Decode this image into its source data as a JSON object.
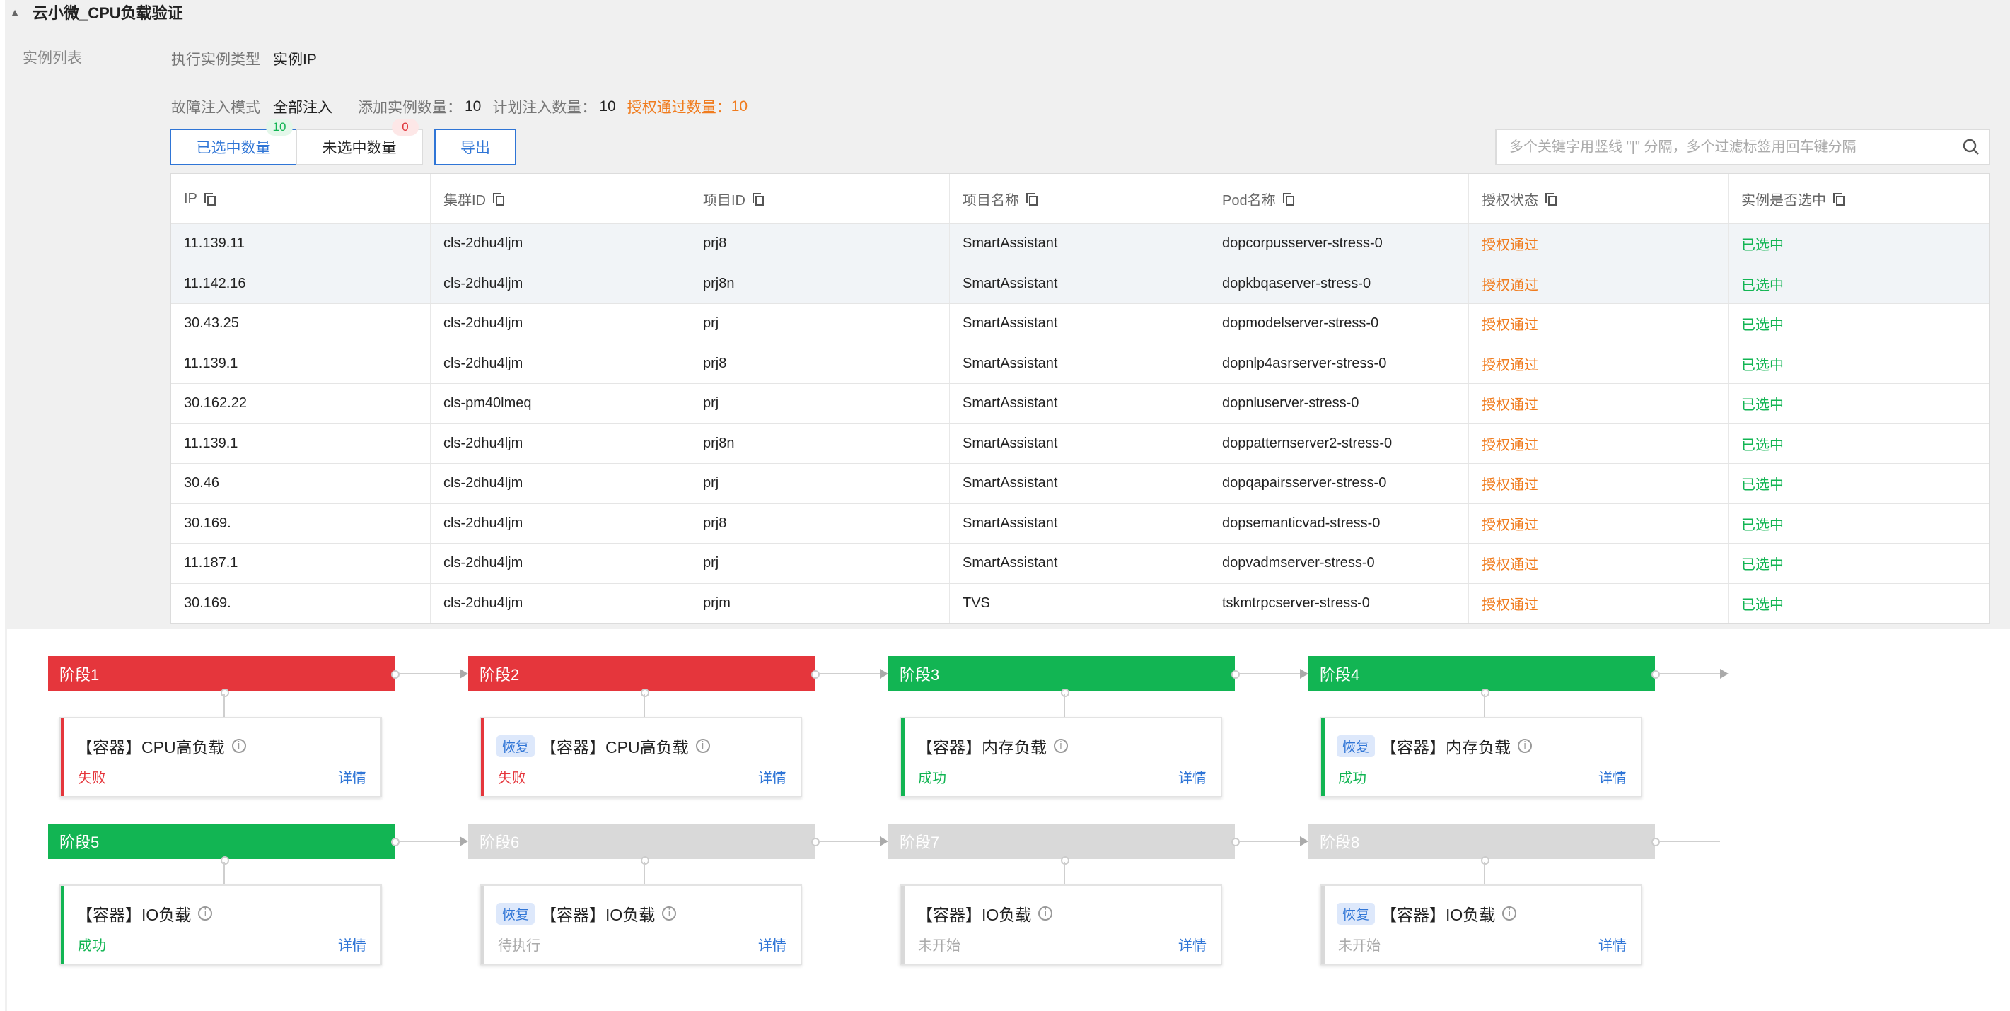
{
  "header": {
    "title": "云小微_CPU负载验证"
  },
  "instance_list": {
    "section_label": "实例列表",
    "exec_type_label": "执行实例类型",
    "exec_type_value": "实例IP",
    "fault_mode_label": "故障注入模式",
    "fault_mode_value": "全部注入",
    "added_count_label": "添加实例数量：",
    "added_count_value": "10",
    "planned_count_label": "计划注入数量：",
    "planned_count_value": "10",
    "auth_pass_label": "授权通过数量：",
    "auth_pass_value": "10"
  },
  "toolbar": {
    "selected_label": "已选中数量",
    "selected_badge": "10",
    "unselected_label": "未选中数量",
    "unselected_badge": "0",
    "export_label": "导出"
  },
  "search": {
    "placeholder": "多个关键字用竖线 \"|\" 分隔，多个过滤标签用回车键分隔"
  },
  "table": {
    "columns": [
      "IP",
      "集群ID",
      "项目ID",
      "项目名称",
      "Pod名称",
      "授权状态",
      "实例是否选中"
    ],
    "rows": [
      [
        "11.139.11",
        "cls-2dhu4ljm",
        "prj8",
        "SmartAssistant",
        "dopcorpusserver-stress-0",
        "授权通过",
        "已选中"
      ],
      [
        "11.142.16",
        "cls-2dhu4ljm",
        "prj8n",
        "SmartAssistant",
        "dopkbqaserver-stress-0",
        "授权通过",
        "已选中"
      ],
      [
        "30.43.25",
        "cls-2dhu4ljm",
        "prj",
        "SmartAssistant",
        "dopmodelserver-stress-0",
        "授权通过",
        "已选中"
      ],
      [
        "11.139.1",
        "cls-2dhu4ljm",
        "prj8",
        "SmartAssistant",
        "dopnlp4asrserver-stress-0",
        "授权通过",
        "已选中"
      ],
      [
        "30.162.22",
        "cls-pm40lmeq",
        "prj",
        "SmartAssistant",
        "dopnluserver-stress-0",
        "授权通过",
        "已选中"
      ],
      [
        "11.139.1",
        "cls-2dhu4ljm",
        "prj8n",
        "SmartAssistant",
        "doppatternserver2-stress-0",
        "授权通过",
        "已选中"
      ],
      [
        "30.46",
        "cls-2dhu4ljm",
        "prj",
        "SmartAssistant",
        "dopqapairsserver-stress-0",
        "授权通过",
        "已选中"
      ],
      [
        "30.169.",
        "cls-2dhu4ljm",
        "prj8",
        "SmartAssistant",
        "dopsemanticvad-stress-0",
        "授权通过",
        "已选中"
      ],
      [
        "11.187.1",
        "cls-2dhu4ljm",
        "prj",
        "SmartAssistant",
        "dopvadmserver-stress-0",
        "授权通过",
        "已选中"
      ],
      [
        "30.169.",
        "cls-2dhu4ljm",
        "prjm",
        "TVS",
        "tskmtrpcserver-stress-0",
        "授权通过",
        "已选中"
      ]
    ]
  },
  "stages": [
    {
      "name": "阶段1",
      "color": "#e5363c",
      "task_tag": "",
      "task": "【容器】CPU高负载",
      "status": "失败",
      "detail": "详情"
    },
    {
      "name": "阶段2",
      "color": "#e5363c",
      "task_tag": "恢复",
      "task": "【容器】CPU高负载",
      "status": "失败",
      "detail": "详情"
    },
    {
      "name": "阶段3",
      "color": "#12b553",
      "task_tag": "",
      "task": "【容器】内存负载",
      "status": "成功",
      "detail": "详情"
    },
    {
      "name": "阶段4",
      "color": "#12b553",
      "task_tag": "恢复",
      "task": "【容器】内存负载",
      "status": "成功",
      "detail": "详情"
    },
    {
      "name": "阶段5",
      "color": "#12b553",
      "task_tag": "",
      "task": "【容器】IO负载",
      "status": "成功",
      "detail": "详情"
    },
    {
      "name": "阶段6",
      "color": "#d9d9d9",
      "task_tag": "恢复",
      "task": "【容器】IO负载",
      "status": "待执行",
      "detail": "详情"
    },
    {
      "name": "阶段7",
      "color": "#d9d9d9",
      "task_tag": "",
      "task": "【容器】IO负载",
      "status": "未开始",
      "detail": "详情"
    },
    {
      "name": "阶段8",
      "color": "#d9d9d9",
      "task_tag": "恢复",
      "task": "【容器】IO负载",
      "status": "未开始",
      "detail": "详情"
    }
  ]
}
